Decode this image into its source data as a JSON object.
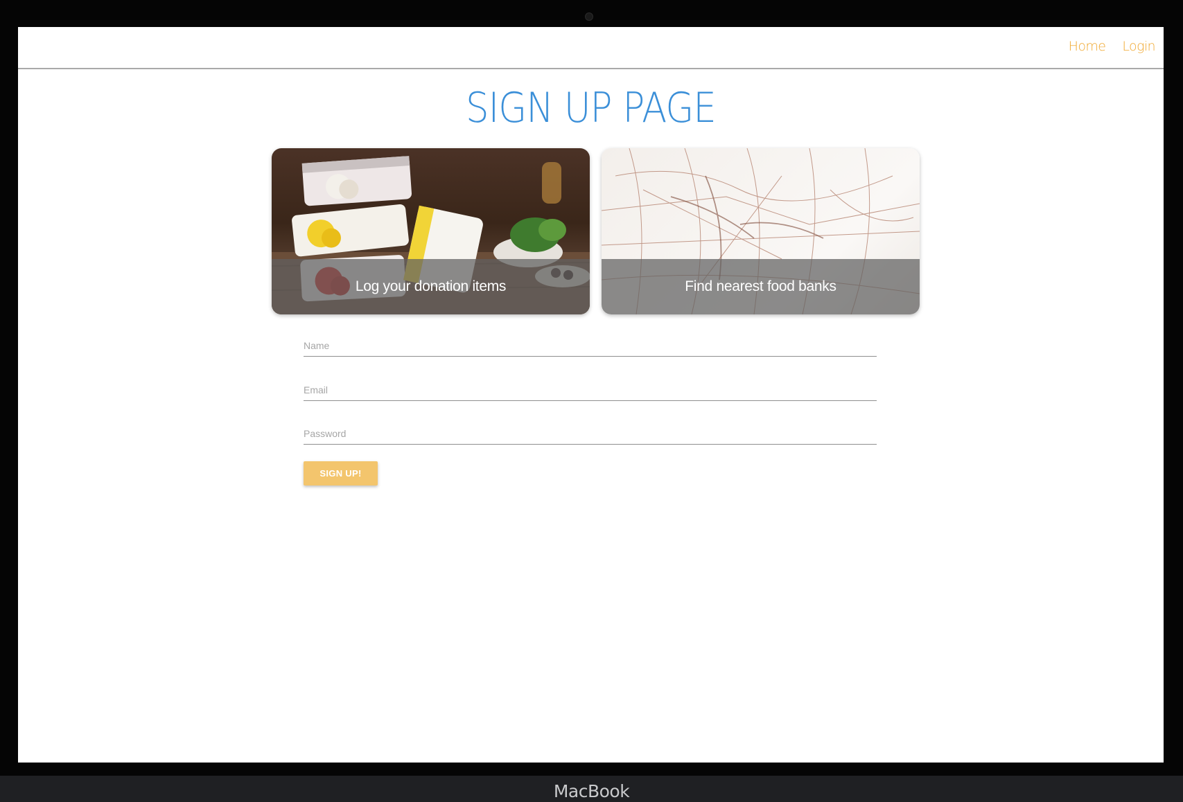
{
  "device": {
    "brand": "MacBook"
  },
  "nav": {
    "links": [
      "Home",
      "Login"
    ]
  },
  "page": {
    "title": "SIGN UP PAGE"
  },
  "cards": [
    {
      "caption": "Log your donation items"
    },
    {
      "caption": "Find nearest food banks"
    }
  ],
  "form": {
    "name_placeholder": "Name",
    "email_placeholder": "Email",
    "password_placeholder": "Password",
    "submit_label": "SIGN UP!"
  },
  "colors": {
    "nav_link": "#f0a830",
    "title": "#3b8fd8",
    "button": "#f3c56d"
  }
}
